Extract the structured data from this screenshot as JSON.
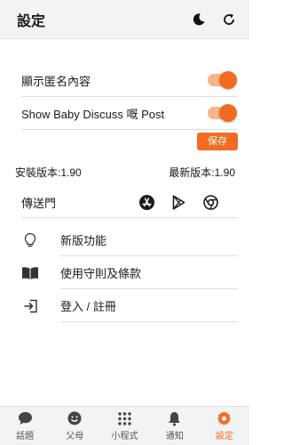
{
  "header": {
    "title": "設定",
    "moon_icon": "moon-icon",
    "refresh_icon": "refresh-icon"
  },
  "settings": {
    "anonymous": {
      "label": "顯示匿名內容",
      "on": true
    },
    "baby_discuss": {
      "label": "Show Baby Discuss 嘅 Post",
      "on": true
    },
    "save_label": "保存"
  },
  "version": {
    "installed": "安裝版本:1.90",
    "latest": "最新版本:1.90"
  },
  "portal": {
    "label": "傳送門",
    "icons": [
      "app-store-icon",
      "google-play-icon",
      "chrome-icon"
    ]
  },
  "menu": [
    {
      "label": "新版功能",
      "icon": "lightbulb-icon"
    },
    {
      "label": "使用守則及條款",
      "icon": "book-icon"
    },
    {
      "label": "登入 / 註冊",
      "icon": "login-icon"
    }
  ],
  "tabs": [
    {
      "label": "話題",
      "icon": "chat-icon",
      "active": false
    },
    {
      "label": "父母",
      "icon": "smiley-icon",
      "active": false
    },
    {
      "label": "小程式",
      "icon": "grid-icon",
      "active": false
    },
    {
      "label": "通知",
      "icon": "bell-icon",
      "active": false
    },
    {
      "label": "設定",
      "icon": "gear-icon",
      "active": true
    }
  ],
  "colors": {
    "accent": "#f26b21",
    "toggle_track": "#f6b48b",
    "header_bg": "#f2f3f5"
  }
}
